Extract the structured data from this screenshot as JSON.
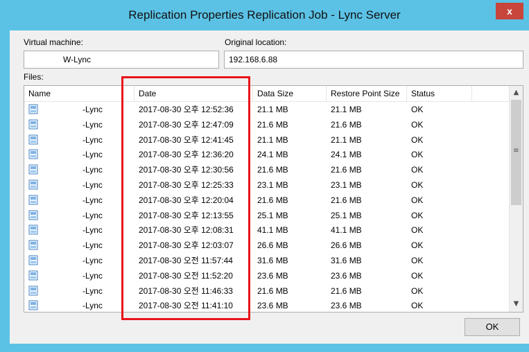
{
  "window": {
    "title": "Replication Properties Replication Job - Lync Server",
    "close_glyph": "x"
  },
  "vm": {
    "label": "Virtual machine:",
    "value": "W-Lync"
  },
  "location": {
    "label": "Original location:",
    "value": "192.168.6.88"
  },
  "files": {
    "label": "Files:",
    "columns": [
      "Name",
      "Date",
      "Data Size",
      "Restore Point Size",
      "Status"
    ],
    "rows": [
      {
        "name": "-Lync",
        "date": "2017-08-30 오후 12:52:36",
        "data_size": "21.1 MB",
        "rp_size": "21.1 MB",
        "status": "OK"
      },
      {
        "name": "-Lync",
        "date": "2017-08-30 오후 12:47:09",
        "data_size": "21.6 MB",
        "rp_size": "21.6 MB",
        "status": "OK"
      },
      {
        "name": "-Lync",
        "date": "2017-08-30 오후 12:41:45",
        "data_size": "21.1 MB",
        "rp_size": "21.1 MB",
        "status": "OK"
      },
      {
        "name": "-Lync",
        "date": "2017-08-30 오후 12:36:20",
        "data_size": "24.1 MB",
        "rp_size": "24.1 MB",
        "status": "OK"
      },
      {
        "name": "-Lync",
        "date": "2017-08-30 오후 12:30:56",
        "data_size": "21.6 MB",
        "rp_size": "21.6 MB",
        "status": "OK"
      },
      {
        "name": "-Lync",
        "date": "2017-08-30 오후 12:25:33",
        "data_size": "23.1 MB",
        "rp_size": "23.1 MB",
        "status": "OK"
      },
      {
        "name": "-Lync",
        "date": "2017-08-30 오후 12:20:04",
        "data_size": "21.6 MB",
        "rp_size": "21.6 MB",
        "status": "OK"
      },
      {
        "name": "-Lync",
        "date": "2017-08-30 오후 12:13:55",
        "data_size": "25.1 MB",
        "rp_size": "25.1 MB",
        "status": "OK"
      },
      {
        "name": "-Lync",
        "date": "2017-08-30 오후 12:08:31",
        "data_size": "41.1 MB",
        "rp_size": "41.1 MB",
        "status": "OK"
      },
      {
        "name": "-Lync",
        "date": "2017-08-30 오후 12:03:07",
        "data_size": "26.6 MB",
        "rp_size": "26.6 MB",
        "status": "OK"
      },
      {
        "name": "-Lync",
        "date": "2017-08-30 오전 11:57:44",
        "data_size": "31.6 MB",
        "rp_size": "31.6 MB",
        "status": "OK"
      },
      {
        "name": "-Lync",
        "date": "2017-08-30 오전 11:52:20",
        "data_size": "23.6 MB",
        "rp_size": "23.6 MB",
        "status": "OK"
      },
      {
        "name": "-Lync",
        "date": "2017-08-30 오전 11:46:33",
        "data_size": "21.6 MB",
        "rp_size": "21.6 MB",
        "status": "OK"
      },
      {
        "name": "-Lync",
        "date": "2017-08-30 오전 11:41:10",
        "data_size": "23.6 MB",
        "rp_size": "23.6 MB",
        "status": "OK"
      }
    ]
  },
  "scrollbar": {
    "up_glyph": "▲",
    "down_glyph": "▼",
    "grip_glyph": "≡"
  },
  "ok_button": "OK",
  "colors": {
    "titlebar": "#5bc2e6",
    "close": "#c7453b",
    "highlight": "#e8141a"
  }
}
